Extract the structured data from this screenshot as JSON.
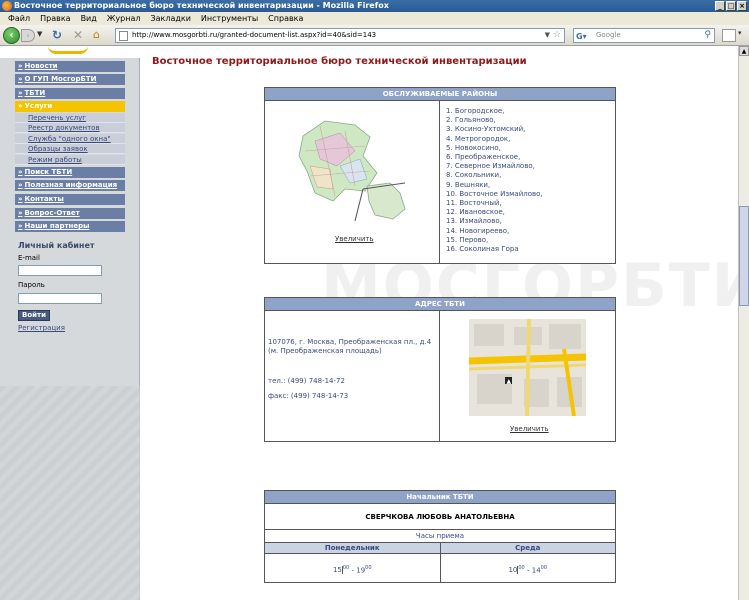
{
  "window": {
    "title": "Восточное территориальное бюро технической инвентаризации - Mozilla Firefox"
  },
  "menubar": [
    "Файл",
    "Правка",
    "Вид",
    "Журнал",
    "Закладки",
    "Инструменты",
    "Справка"
  ],
  "toolbar": {
    "url": "http://www.mosgorbti.ru/granted-document-list.aspx?id=40&sid=143",
    "search_placeholder": "Google"
  },
  "sidebar": {
    "menu": [
      {
        "label": "Новости",
        "active": false
      },
      {
        "label": "О ГУП МосгорБТИ",
        "active": false
      },
      {
        "label": "ТБТИ",
        "active": false
      },
      {
        "label": "Услуги",
        "active": true
      },
      {
        "label": "Поиск ТБТИ",
        "active": false
      },
      {
        "label": "Полезная информация",
        "active": false
      },
      {
        "label": "Контакты",
        "active": false
      },
      {
        "label": "Вопрос-Ответ",
        "active": false
      },
      {
        "label": "Наши партнеры",
        "active": false
      }
    ],
    "submenu": [
      "Перечень услуг",
      "Реестр документов",
      "Служба \"одного окна\"",
      "Образцы заявок",
      "Режим работы"
    ],
    "cabinet": {
      "title": "Личный кабинет",
      "email_label": "E-mail",
      "password_label": "Пароль",
      "login_button": "Войти",
      "register_link": "Регистрация"
    }
  },
  "main": {
    "title": "Восточное территориальное бюро технической инвентаризации",
    "watermark": "МОСГОРБТИ",
    "districts": {
      "header": "ОБСЛУЖИВАЕМЫЕ РАЙОНЫ",
      "enlarge": "Увеличить",
      "items": [
        "1. Богородское,",
        "2. Гольяново,",
        "3. Косино-Ухтомский,",
        "4. Метрогородок,",
        "5. Новокосино,",
        "6. Преображенское,",
        "7. Северное Измайлово,",
        "8. Сокольники,",
        "9. Вешняки,",
        "10. Восточное Измайлово,",
        "11. Восточный,",
        "12. Ивановское,",
        "13. Измайлово,",
        "14. Новогиреево,",
        "15. Перово,",
        "16. Соколиная Гора"
      ]
    },
    "address": {
      "header": "АДРЕС ТБТИ",
      "line1": "107076, г. Москва, Преображенская пл., д.4",
      "line2": "(м. Преображенская площадь)",
      "phone": "тел.: (499) 748-14-72",
      "fax": "факс: (499) 748-14-73",
      "enlarge": "Увеличить"
    },
    "chief": {
      "header": "Начальник ТБТИ",
      "name": "СВЕРЧКОВА ЛЮБОВЬ АНАТОЛЬЕВНА",
      "hours_label": "Часы приема",
      "day1": "Понедельник",
      "day2": "Среда",
      "time1_start": "15",
      "time1_start_min": "00",
      "time1_end": "19",
      "time1_end_min": "00",
      "time2_start": "10",
      "time2_start_min": "00",
      "time2_end": "14",
      "time2_end_min": "00"
    }
  }
}
